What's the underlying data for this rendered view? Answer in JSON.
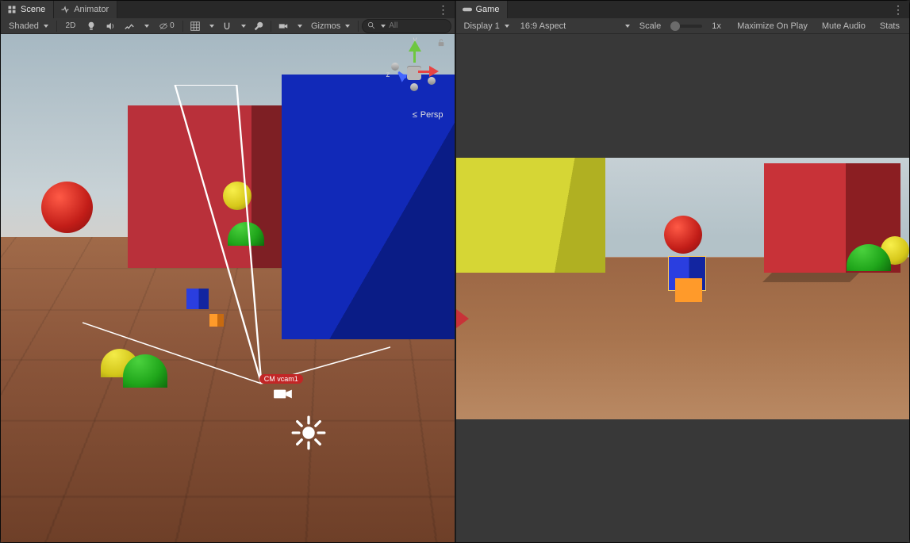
{
  "scene_panel": {
    "tabs": {
      "scene": "Scene",
      "animator": "Animator"
    },
    "toolbar": {
      "shading": "Shaded",
      "button_2d": "2D",
      "gizmos": "Gizmos",
      "search_placeholder": "All"
    },
    "gizmo": {
      "x": "x",
      "y": "y",
      "z": "z",
      "projection": "Persp",
      "projection_back": "≤"
    },
    "overlays": {
      "cam_label": "CM vcam1"
    }
  },
  "game_panel": {
    "tabs": {
      "game": "Game"
    },
    "toolbar": {
      "display": "Display 1",
      "aspect": "16:9 Aspect",
      "scale_label": "Scale",
      "scale_value": "1x",
      "maximize": "Maximize On Play",
      "mute": "Mute Audio",
      "stats": "Stats"
    }
  }
}
